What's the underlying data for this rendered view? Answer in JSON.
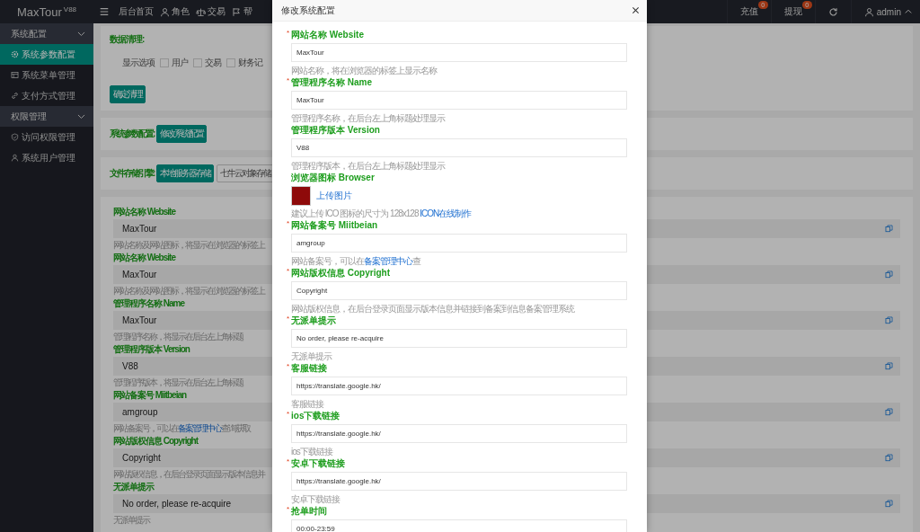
{
  "topbar": {
    "logo": "MaxTour",
    "version": "V88",
    "nav": [
      {
        "label": "后台首页"
      },
      {
        "label": "角色"
      },
      {
        "label": "交易"
      },
      {
        "label": "帮"
      }
    ],
    "counters": [
      {
        "label": "充值",
        "badge": "0"
      },
      {
        "label": "提现",
        "badge": "0"
      }
    ],
    "user": "admin"
  },
  "sidebar": {
    "groups": [
      {
        "label": "系统配置",
        "expanded": true,
        "items": [
          {
            "label": "系统参数配置",
            "selected": true
          },
          {
            "label": "系统菜单管理",
            "selected": false
          },
          {
            "label": "支付方式管理",
            "selected": false
          }
        ]
      },
      {
        "label": "权限管理",
        "expanded": true,
        "items": [
          {
            "label": "访问权限管理",
            "selected": false
          },
          {
            "label": "系统用户管理",
            "selected": false
          }
        ]
      }
    ]
  },
  "cleanup": {
    "label": "数据清理:",
    "option_label": "显示选项",
    "options": [
      {
        "label": "用户",
        "checked": false
      },
      {
        "label": "交易",
        "checked": false
      },
      {
        "label": "财务记",
        "checked": false
      }
    ],
    "button": "确定清理"
  },
  "system_config": {
    "label": "系统参数配置:",
    "button": "修改系统配置"
  },
  "storage": {
    "label": "文件存储引擎:",
    "options": [
      {
        "label": "本地服务器存储",
        "selected": true
      },
      {
        "label": "七牛云对象存储",
        "selected": false
      }
    ]
  },
  "settings_form": {
    "fields": [
      {
        "label": "网站名称 Website",
        "value": "MaxTour",
        "hint": "网站名称及网站图标，将显示在浏览器的标签上"
      },
      {
        "label": "网站名称 Website",
        "value": "MaxTour",
        "hint": "网站名称及网站图标，将显示在浏览器的标签上"
      },
      {
        "label": "管理程序名称 Name",
        "value": "MaxTour",
        "hint": "管理程序名称，将显示在后台左上角标题"
      },
      {
        "label": "管理程序版本 Version",
        "value": "V88",
        "hint": "管理程序版本，将显示在后台左上角标题"
      },
      {
        "label": "网站备案号 Miitbeian",
        "value": "amgroup",
        "hint": "网站备案号，可以在",
        "hint_link": "备案管理中心",
        "hint_tail": "查询获取"
      },
      {
        "label": "网站版权信息 Copyright",
        "value": "Copyright",
        "hint": "网站版权信息，在后台登录页面显示版本信息并"
      },
      {
        "label": "无派单提示",
        "value": "No order, please re-acquire",
        "hint": "无派单提示"
      }
    ]
  },
  "modal": {
    "title": "修改系统配置",
    "required_mark": "*",
    "fields": [
      {
        "kind": "text",
        "label": "网站名称 Website",
        "required": true,
        "value": "MaxTour",
        "hint": "网站名称，将在浏览器的标签上显示名称"
      },
      {
        "kind": "text",
        "label": "管理程序名称 Name",
        "required": true,
        "value": "MaxTour",
        "hint": "管理程序名称，在后台左上角标题处理显示"
      },
      {
        "kind": "text",
        "label": "管理程序版本 Version",
        "required": false,
        "value": "V88",
        "hint": "管理程序版本，在后台左上角标题处理显示"
      },
      {
        "kind": "image",
        "label": "浏览器图标 Browser",
        "required": false,
        "upload": "上传图片",
        "hint": "建议上传 ICO 图标的尺寸为 128x128 ",
        "hint_link": "ICON在线制作"
      },
      {
        "kind": "text",
        "label": "网站备案号 Miitbeian",
        "required": true,
        "value": "amgroup",
        "hint": "网站备案号，可以在",
        "hint_link": "备案管理中心",
        "hint_tail": "查"
      },
      {
        "kind": "text",
        "label": "网站版权信息 Copyright",
        "required": true,
        "value": "Copyright",
        "hint": "网站版权信息，在后台登录页面显示版本信息并链接到备案到信息备案管理系统"
      },
      {
        "kind": "text",
        "label": "无派单提示",
        "required": true,
        "value": "No order, please re-acquire",
        "hint": "无派单提示"
      },
      {
        "kind": "text",
        "label": "客服链接",
        "required": true,
        "value": "https://translate.google.hk/",
        "hint": "客服链接"
      },
      {
        "kind": "text",
        "label": "ios下载链接",
        "required": true,
        "value": "https://translate.google.hk/",
        "hint": "ios下载链接"
      },
      {
        "kind": "text",
        "label": "安卓下载链接",
        "required": true,
        "value": "https://translate.google.hk/",
        "hint": "安卓下载链接"
      },
      {
        "kind": "text",
        "label": "抢单时间",
        "required": true,
        "value": "00:00-23:59"
      }
    ]
  }
}
